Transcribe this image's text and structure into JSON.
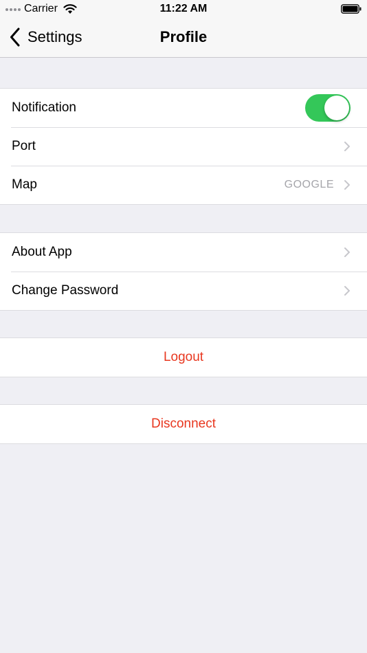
{
  "status_bar": {
    "carrier": "Carrier",
    "time": "11:22 AM"
  },
  "nav": {
    "back_label": "Settings",
    "title": "Profile"
  },
  "sections": {
    "preferences": {
      "notification_label": "Notification",
      "notification_on": true,
      "port_label": "Port",
      "map_label": "Map",
      "map_value": "GOOGLE"
    },
    "info": {
      "about_label": "About App",
      "password_label": "Change Password"
    },
    "logout_label": "Logout",
    "disconnect_label": "Disconnect"
  },
  "colors": {
    "destructive": "#e8371f",
    "switch_on": "#34c759",
    "grouped_background": "#efeff4"
  },
  "icons": [
    "cellular-signal-icon",
    "wifi-icon",
    "battery-icon",
    "back-chevron-icon",
    "disclosure-chevron-icon"
  ]
}
